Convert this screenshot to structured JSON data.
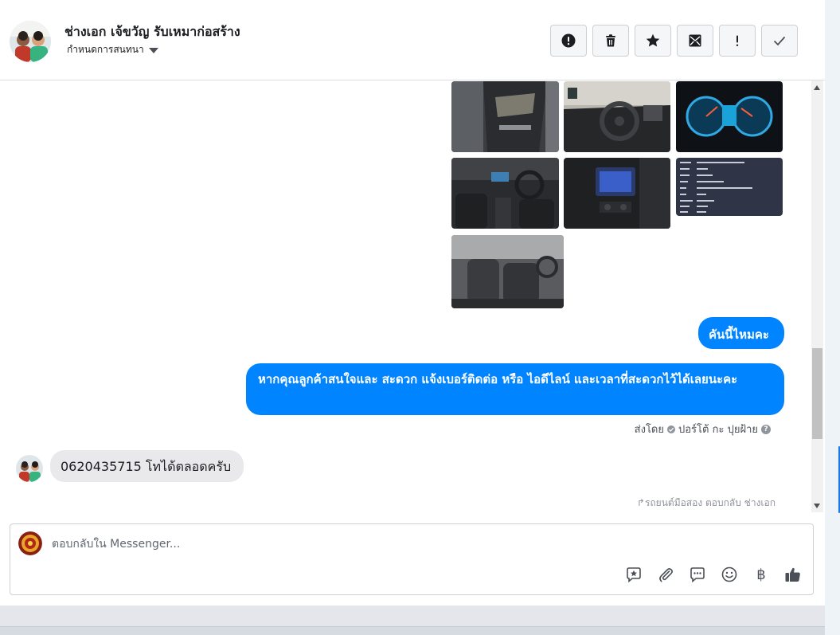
{
  "header": {
    "title": "ช่างเอก เจ้ขวัญ รับเหมาก่อสร้าง",
    "subtitle": "กำหนดการสนทนา"
  },
  "thread": {
    "messages_out": [
      "คันนี้ไหมคะ",
      "หากคุณลูกค้าสนใจและ สะดวก แจ้งเบอร์ติดต่อ หรือ ไอดีไลน์ และเวลาที่สะดวกไว้ได้เลยนะคะ"
    ],
    "sent_by_label": "ส่งโดย",
    "sent_by_name": "ปอร์โต้ กะ ปุยฝ้าย",
    "message_in": "0620435715 โทได้ตลอดครับ",
    "reply_note": "รถยนต์มือสอง ตอบกลับ ช่างเอก"
  },
  "composer": {
    "placeholder": "ตอบกลับใน Messenger..."
  },
  "icons": {
    "header_actions": [
      "exclamation-circle-icon",
      "trash-icon",
      "star-icon",
      "mark-unread-icon",
      "exclamation-icon",
      "check-icon"
    ],
    "tools": [
      "sticker-icon",
      "paperclip-icon",
      "saved-reply-icon",
      "emoji-icon",
      "baht-icon",
      "thumbs-up-icon"
    ]
  },
  "colors": {
    "outgoing_bubble": "#0084ff",
    "incoming_bubble": "#e9e9eb",
    "accent": "#1877f2"
  }
}
